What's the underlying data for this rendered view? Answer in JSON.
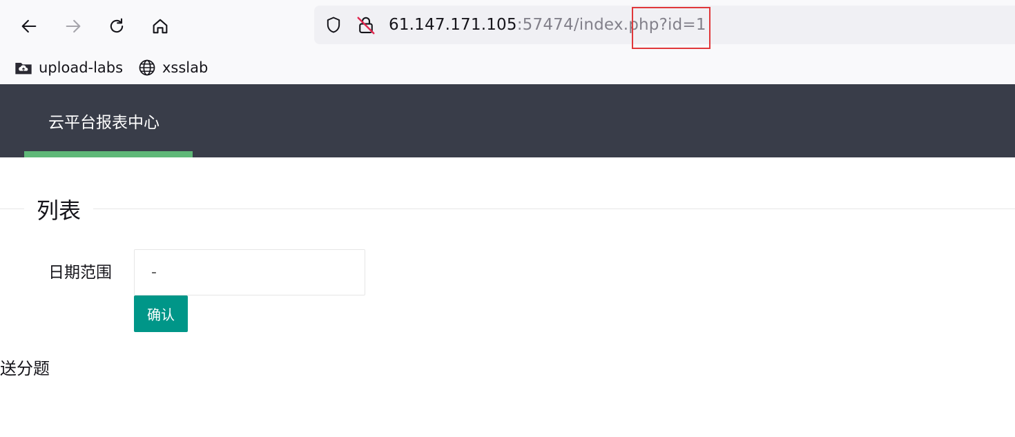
{
  "browser": {
    "url": {
      "host": "61.147.171.105",
      "rest": ":57474/index.php?id=1"
    },
    "bookmarks": [
      {
        "label": "upload-labs",
        "icon": "cloud-folder-icon"
      },
      {
        "label": "xsslab",
        "icon": "globe-icon"
      }
    ],
    "highlight_color": "#e0373a"
  },
  "header": {
    "title": "云平台报表中心",
    "background": "#393d49",
    "accent": "#5fb878"
  },
  "section": {
    "legend": "列表"
  },
  "form": {
    "date_label": "日期范围",
    "date_value": "-",
    "confirm_label": "确认",
    "button_color": "#009688"
  },
  "footer": {
    "text": "送分题"
  }
}
